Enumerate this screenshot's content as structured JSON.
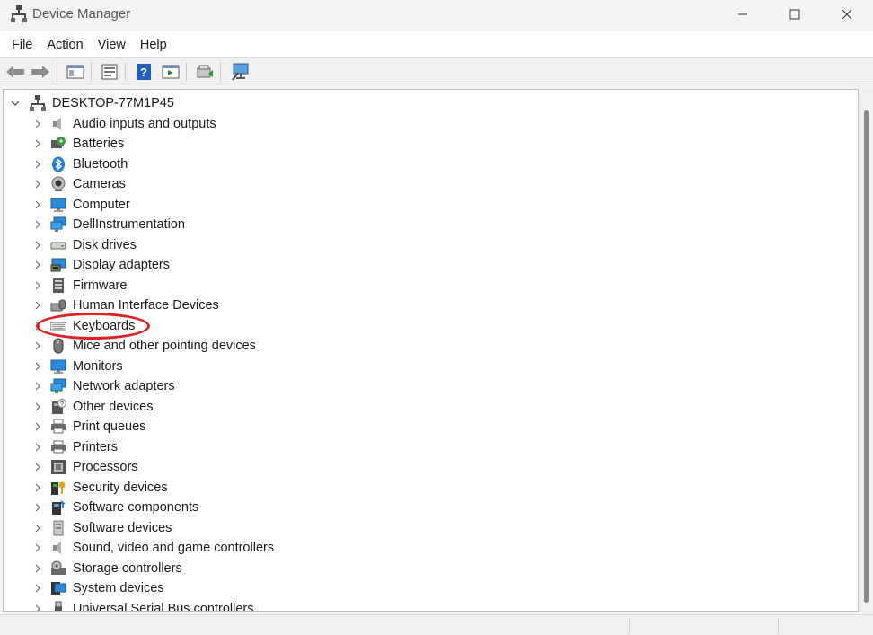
{
  "window": {
    "title": "Device Manager"
  },
  "menu": [
    "File",
    "Action",
    "View",
    "Help"
  ],
  "toolbar": {
    "buttons": [
      "back-arrow-icon",
      "forward-arrow-icon",
      "show-hide-console-tree-icon",
      "properties-icon",
      "help-icon",
      "action-pane-icon",
      "update-driver-icon",
      "scan-hardware-icon"
    ]
  },
  "tree": {
    "root": "DESKTOP-77M1P45",
    "categories": [
      {
        "label": "Audio inputs and outputs",
        "icon": "speaker-icon"
      },
      {
        "label": "Batteries",
        "icon": "battery-icon"
      },
      {
        "label": "Bluetooth",
        "icon": "bluetooth-icon"
      },
      {
        "label": "Cameras",
        "icon": "camera-icon"
      },
      {
        "label": "Computer",
        "icon": "computer-icon"
      },
      {
        "label": "DellInstrumentation",
        "icon": "network-monitor-icon"
      },
      {
        "label": "Disk drives",
        "icon": "disk-drive-icon"
      },
      {
        "label": "Display adapters",
        "icon": "display-adapter-icon"
      },
      {
        "label": "Firmware",
        "icon": "firmware-icon"
      },
      {
        "label": "Human Interface Devices",
        "icon": "hid-icon"
      },
      {
        "label": "Keyboards",
        "icon": "keyboard-icon"
      },
      {
        "label": "Mice and other pointing devices",
        "icon": "mouse-icon"
      },
      {
        "label": "Monitors",
        "icon": "monitor-icon"
      },
      {
        "label": "Network adapters",
        "icon": "network-adapter-icon"
      },
      {
        "label": "Other devices",
        "icon": "other-device-icon"
      },
      {
        "label": "Print queues",
        "icon": "print-queue-icon"
      },
      {
        "label": "Printers",
        "icon": "printer-icon"
      },
      {
        "label": "Processors",
        "icon": "processor-icon"
      },
      {
        "label": "Security devices",
        "icon": "security-device-icon"
      },
      {
        "label": "Software components",
        "icon": "software-component-icon"
      },
      {
        "label": "Software devices",
        "icon": "software-device-icon"
      },
      {
        "label": "Sound, video and game controllers",
        "icon": "sound-controller-icon"
      },
      {
        "label": "Storage controllers",
        "icon": "storage-controller-icon"
      },
      {
        "label": "System devices",
        "icon": "system-device-icon"
      },
      {
        "label": "Universal Serial Bus controllers",
        "icon": "usb-controller-icon"
      }
    ]
  },
  "annotation": {
    "highlighted_item": "Keyboards",
    "color": "#e02020"
  }
}
